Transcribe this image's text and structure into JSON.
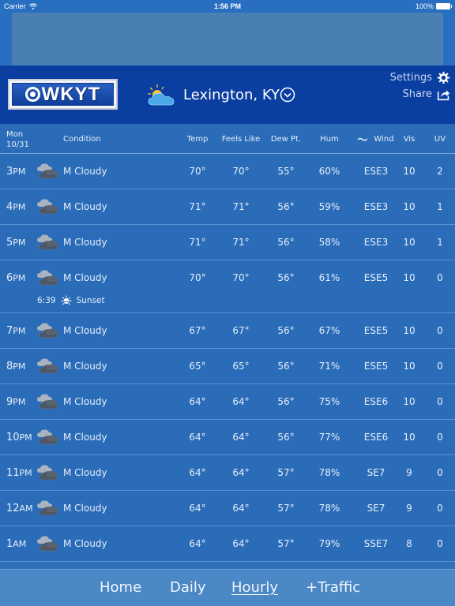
{
  "status_bar": {
    "carrier": "Carrier",
    "time": "1:56 PM",
    "battery": "100%"
  },
  "header": {
    "logo_text": "WKYT",
    "location": "Lexington, KY",
    "location_icon": "partly-cloudy-icon",
    "settings_label": "Settings",
    "share_label": "Share"
  },
  "table": {
    "day": "Mon",
    "date": "10/31",
    "headers": {
      "condition": "Condition",
      "temp": "Temp",
      "feels_like": "Feels Like",
      "dew_point": "Dew Pt.",
      "humidity": "Hum",
      "wind": "Wind",
      "visibility": "Vis",
      "uv": "UV"
    },
    "rows": [
      {
        "hour": "3",
        "ampm": "PM",
        "icon": "mostly-cloudy-icon",
        "condition": "M Cloudy",
        "temp": "70°",
        "feels": "70°",
        "dew": "55°",
        "hum": "60%",
        "wind": "ESE3",
        "vis": "10",
        "uv": "2"
      },
      {
        "hour": "4",
        "ampm": "PM",
        "icon": "mostly-cloudy-icon",
        "condition": "M Cloudy",
        "temp": "71°",
        "feels": "71°",
        "dew": "56°",
        "hum": "59%",
        "wind": "ESE3",
        "vis": "10",
        "uv": "1"
      },
      {
        "hour": "5",
        "ampm": "PM",
        "icon": "mostly-cloudy-icon",
        "condition": "M Cloudy",
        "temp": "71°",
        "feels": "71°",
        "dew": "56°",
        "hum": "58%",
        "wind": "ESE3",
        "vis": "10",
        "uv": "1"
      },
      {
        "hour": "6",
        "ampm": "PM",
        "icon": "mostly-cloudy-icon",
        "condition": "M Cloudy",
        "temp": "70°",
        "feels": "70°",
        "dew": "56°",
        "hum": "61%",
        "wind": "ESE5",
        "vis": "10",
        "uv": "0",
        "event": {
          "time": "6:39",
          "label": "Sunset",
          "icon": "sunset-icon"
        }
      },
      {
        "hour": "7",
        "ampm": "PM",
        "icon": "mostly-cloudy-icon",
        "condition": "M Cloudy",
        "temp": "67°",
        "feels": "67°",
        "dew": "56°",
        "hum": "67%",
        "wind": "ESE5",
        "vis": "10",
        "uv": "0"
      },
      {
        "hour": "8",
        "ampm": "PM",
        "icon": "mostly-cloudy-icon",
        "condition": "M Cloudy",
        "temp": "65°",
        "feels": "65°",
        "dew": "56°",
        "hum": "71%",
        "wind": "ESE5",
        "vis": "10",
        "uv": "0"
      },
      {
        "hour": "9",
        "ampm": "PM",
        "icon": "mostly-cloudy-icon",
        "condition": "M Cloudy",
        "temp": "64°",
        "feels": "64°",
        "dew": "56°",
        "hum": "75%",
        "wind": "ESE6",
        "vis": "10",
        "uv": "0"
      },
      {
        "hour": "10",
        "ampm": "PM",
        "icon": "mostly-cloudy-icon",
        "condition": "M Cloudy",
        "temp": "64°",
        "feels": "64°",
        "dew": "56°",
        "hum": "77%",
        "wind": "ESE6",
        "vis": "10",
        "uv": "0"
      },
      {
        "hour": "11",
        "ampm": "PM",
        "icon": "mostly-cloudy-icon",
        "condition": "M Cloudy",
        "temp": "64°",
        "feels": "64°",
        "dew": "57°",
        "hum": "78%",
        "wind": "SE7",
        "vis": "9",
        "uv": "0"
      },
      {
        "hour": "12",
        "ampm": "AM",
        "icon": "mostly-cloudy-icon",
        "condition": "M Cloudy",
        "temp": "64°",
        "feels": "64°",
        "dew": "57°",
        "hum": "78%",
        "wind": "SE7",
        "vis": "9",
        "uv": "0"
      },
      {
        "hour": "1",
        "ampm": "AM",
        "icon": "mostly-cloudy-icon",
        "condition": "M Cloudy",
        "temp": "64°",
        "feels": "64°",
        "dew": "57°",
        "hum": "79%",
        "wind": "SSE7",
        "vis": "8",
        "uv": "0"
      }
    ]
  },
  "nav": {
    "items": [
      {
        "label": "Home",
        "active": false
      },
      {
        "label": "Daily",
        "active": false
      },
      {
        "label": "Hourly",
        "active": true
      },
      {
        "label": "+Traffic",
        "active": false
      }
    ]
  }
}
